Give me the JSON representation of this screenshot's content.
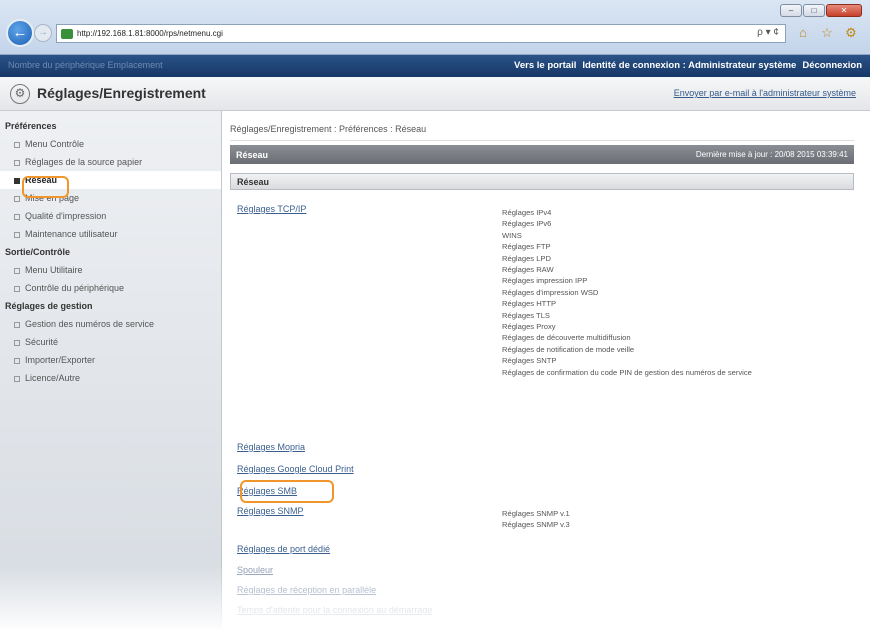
{
  "browser": {
    "url": "http://192.168.1.81:8000/rps/netmenu.cgi",
    "window_buttons": [
      "–",
      "□",
      "✕"
    ],
    "addr_tools": "ρ ▾ ¢",
    "tool_icons": [
      "⌂",
      "☆",
      "⚙"
    ]
  },
  "topbar": {
    "left_text": "Nombre du périphérique   Emplacement",
    "portal": "Vers le portail",
    "identity": "Identité de connexion : Administrateur système",
    "logout": "Déconnexion"
  },
  "header": {
    "title": "Réglages/Enregistrement",
    "mail_link": "Envoyer par e-mail à l'administrateur système"
  },
  "sidebar": {
    "preferences_title": "Préférences",
    "preferences": [
      "Menu Contrôle",
      "Réglages de la source papier",
      "Réseau",
      "Mise en page",
      "Qualité d'impression",
      "Maintenance utilisateur"
    ],
    "output_title": "Sortie/Contrôle",
    "output": [
      "Menu Utilitaire",
      "Contrôle du périphérique"
    ],
    "mgmt_title": "Réglages de gestion",
    "mgmt": [
      "Gestion des numéros de service",
      "Sécurité",
      "Importer/Exporter",
      "Licence/Autre"
    ]
  },
  "main": {
    "breadcrumb": "Réglages/Enregistrement : Préférences : Réseau",
    "section_title": "Réseau",
    "last_update": "Dernière mise à jour : 20/08 2015 03:39:41",
    "sub_title": "Réseau",
    "tcpip_link": "Réglages TCP/IP",
    "tcpip_items": [
      "Réglages IPv4",
      "Réglages IPv6",
      "WINS",
      "Réglages FTP",
      "Réglages LPD",
      "Réglages RAW",
      "Réglages impression IPP",
      "Réglages d'impression WSD",
      "Réglages HTTP",
      "Réglages TLS",
      "Réglages Proxy",
      "Réglages de découverte multidiffusion",
      "Réglages de notification de mode veille",
      "Réglages SNTP",
      "Réglages de confirmation du code PIN de gestion des numéros de service"
    ],
    "mopria_link": "Réglages Mopria",
    "gcp_link": "Réglages Google Cloud Print",
    "smb_link": "Réglages SMB",
    "snmp_link": "Réglages SNMP",
    "snmp_items": [
      "Réglages SNMP v.1",
      "Réglages SNMP v.3"
    ],
    "port_link": "Réglages de port dédié",
    "spool_link": "Spouleur",
    "parallel_link": "Réglages de réception en parallèle",
    "wait_link": "Temps d'attente pour la connexion au démarrage"
  }
}
